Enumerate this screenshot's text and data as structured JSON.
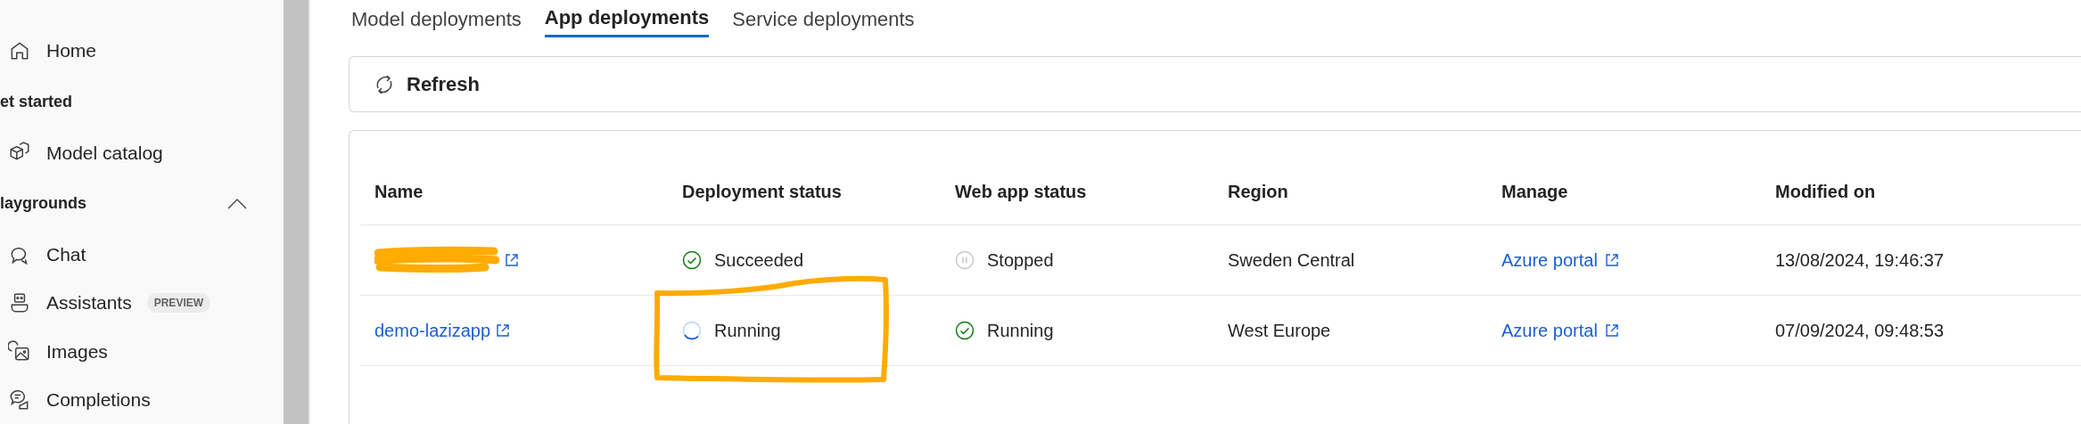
{
  "sidebar": {
    "items": [
      {
        "kind": "link",
        "label": "Home"
      },
      {
        "kind": "section",
        "label": "et started"
      },
      {
        "kind": "link",
        "label": "Model catalog"
      },
      {
        "kind": "group",
        "label": "laygrounds",
        "expanded": true
      },
      {
        "kind": "link",
        "label": "Chat"
      },
      {
        "kind": "link",
        "label": "Assistants",
        "badge": "PREVIEW"
      },
      {
        "kind": "link",
        "label": "Images"
      },
      {
        "kind": "link",
        "label": "Completions"
      }
    ]
  },
  "tabs": [
    {
      "label": "Model deployments",
      "selected": false
    },
    {
      "label": "App deployments",
      "selected": true
    },
    {
      "label": "Service deployments",
      "selected": false
    }
  ],
  "toolbar": {
    "refresh": "Refresh"
  },
  "table": {
    "columns": [
      "Name",
      "Deployment status",
      "Web app status",
      "Region",
      "Manage",
      "Modified on"
    ],
    "rows": [
      {
        "name": "",
        "redacted": true,
        "deployment_status": {
          "kind": "success",
          "text": "Succeeded",
          "highlighted": false
        },
        "web_app_status": {
          "kind": "stopped",
          "text": "Stopped"
        },
        "region": "Sweden Central",
        "manage": "Azure portal",
        "modified_on": "13/08/2024, 19:46:37"
      },
      {
        "name": "demo-lazizapp",
        "redacted": false,
        "deployment_status": {
          "kind": "progress",
          "text": "Running",
          "highlighted": true
        },
        "web_app_status": {
          "kind": "success",
          "text": "Running"
        },
        "region": "West Europe",
        "manage": "Azure portal",
        "modified_on": "07/09/2024, 09:48:53"
      }
    ]
  }
}
